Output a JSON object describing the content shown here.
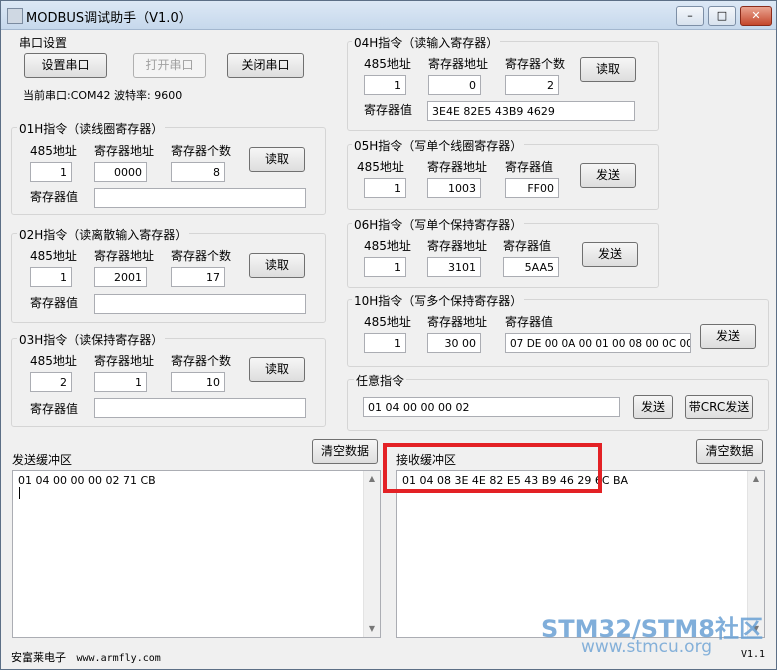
{
  "window": {
    "title": "MODBUS调试助手（V1.0）",
    "min": "–",
    "max": "□",
    "close": "✕"
  },
  "serial": {
    "group": "串口设置",
    "set_btn": "设置串口",
    "open_btn": "打开串口",
    "close_btn": "关闭串口",
    "status": "当前串口:COM42 波特率: 9600"
  },
  "common": {
    "addr485": "485地址",
    "reg_addr": "寄存器地址",
    "reg_count": "寄存器个数",
    "reg_value": "寄存器值",
    "read": "读取",
    "send": "发送"
  },
  "cmd01": {
    "title": "01H指令（读线圈寄存器）",
    "addr485": "1",
    "reg_addr": "0000",
    "reg_count": "8",
    "reg_value": ""
  },
  "cmd02": {
    "title": "02H指令（读离散输入寄存器）",
    "addr485": "1",
    "reg_addr": "2001",
    "reg_count": "17",
    "reg_value": ""
  },
  "cmd03": {
    "title": "03H指令（读保持寄存器）",
    "addr485": "2",
    "reg_addr": "1",
    "reg_count": "10",
    "reg_value": ""
  },
  "cmd04": {
    "title": "04H指令（读输入寄存器）",
    "addr485": "1",
    "reg_addr": "0",
    "reg_count": "2",
    "reg_value": "3E4E 82E5 43B9 4629"
  },
  "cmd05": {
    "title": "05H指令（写单个线圈寄存器）",
    "addr485": "1",
    "reg_addr": "1003",
    "reg_value": "FF00"
  },
  "cmd06": {
    "title": "06H指令（写单个保持寄存器）",
    "addr485": "1",
    "reg_addr": "3101",
    "reg_value": "5AA5"
  },
  "cmd10": {
    "title": "10H指令（写多个保持寄存器）",
    "addr485": "1",
    "reg_addr": "30 00",
    "reg_value": "07 DE  00 0A  00 01  00 08  00 0C  00"
  },
  "any": {
    "title": "任意指令",
    "value": "01 04 00 00 00 02",
    "send": "发送",
    "send_crc": "带CRC发送"
  },
  "send_buf": {
    "label": "发送缓冲区",
    "clear": "清空数据",
    "content": "01 04 00 00 00 02 71 CB"
  },
  "recv_buf": {
    "label": "接收缓冲区",
    "clear": "清空数据",
    "content": "01 04 08 3E 4E 82 E5 43 B9 46 29 6C BA"
  },
  "footer": {
    "company": "安富莱电子",
    "url": "www.armfly.com",
    "version": "V1.1"
  },
  "watermark": {
    "line1": "STM32/STM8社区",
    "line2": "www.stmcu.org"
  },
  "colors": {
    "highlight": "#e32125",
    "watermark": "#6aa1d4"
  }
}
